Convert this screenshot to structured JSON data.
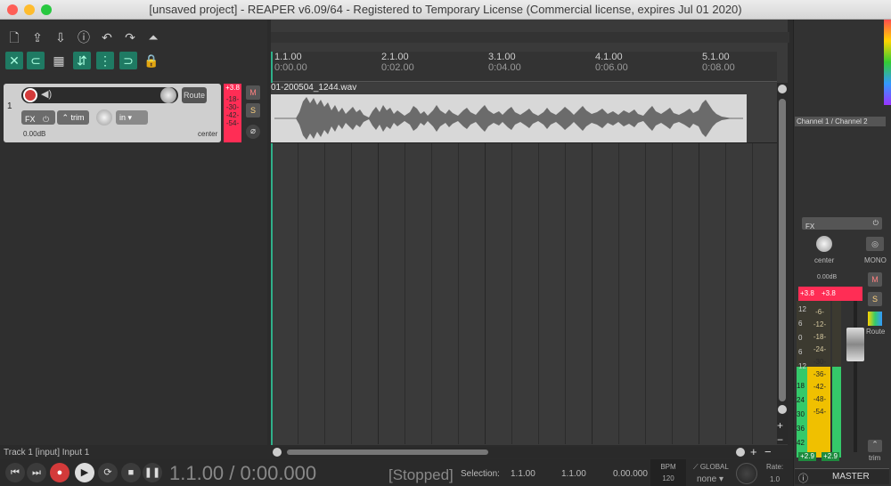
{
  "window": {
    "title": "[unsaved project] - REAPER v6.09/64 - Registered to Temporary License (Commercial license, expires Jul 01 2020)"
  },
  "track": {
    "number": "1",
    "route_label": "Route",
    "fx_label": "FX",
    "trim_label": "trim",
    "input_label": "in",
    "volume": "0.00dB",
    "pan": "center",
    "meter_peak": "+3.8",
    "meter_marks": [
      "-18-",
      "-30-",
      "-42-",
      "-54-"
    ],
    "mute": "M",
    "solo": "S"
  },
  "ruler": {
    "marks": [
      {
        "bar": "1.1.00",
        "time": "0:00.00"
      },
      {
        "bar": "2.1.00",
        "time": "0:02.00"
      },
      {
        "bar": "3.1.00",
        "time": "0:04.00"
      },
      {
        "bar": "4.1.00",
        "time": "0:06.00"
      },
      {
        "bar": "5.1.00",
        "time": "0:08.00"
      }
    ]
  },
  "item": {
    "name": "01-200504_1244.wav"
  },
  "status": {
    "track_input": "Track 1 [input] Input 1"
  },
  "transport": {
    "position": "1.1.00 / 0:00.000",
    "state": "[Stopped]",
    "selection_label": "Selection:",
    "sel_start": "1.1.00",
    "sel_end": "1.1.00",
    "sel_len": "0.00.000",
    "bpm_label": "BPM",
    "bpm": "120",
    "global_label": "GLOBAL",
    "global_value": "none",
    "rate_label": "Rate:",
    "rate": "1.0"
  },
  "master": {
    "routing_label": "Channel 1 / Channel 2",
    "fx_label": "FX",
    "pan": "center",
    "mono": "MONO",
    "volume": "0.00dB",
    "peak_l": "+3.8",
    "peak_r": "+3.8",
    "scale_left": [
      "12",
      "6",
      "0",
      "6",
      "12"
    ],
    "scale_mid": [
      "-6-",
      "-12-",
      "-18-",
      "-24-",
      "-30-",
      "-36-",
      "-42-",
      "-48-",
      "-54-"
    ],
    "scale_lower": [
      "18",
      "24",
      "30",
      "36",
      "42"
    ],
    "rms_l": "+2.9",
    "rms_r": "+2.9",
    "mute": "M",
    "solo": "S",
    "route_label": "Route",
    "trim_label": "trim",
    "name": "MASTER"
  },
  "colors": {
    "accent": "#1f7a63",
    "record": "#d33a3a",
    "meter_clip": "#ff2d55",
    "meter_green": "#35c96a",
    "meter_yellow": "#f0c000",
    "waveform": "#6b6b6b",
    "item_bg": "#d8d8d8"
  }
}
